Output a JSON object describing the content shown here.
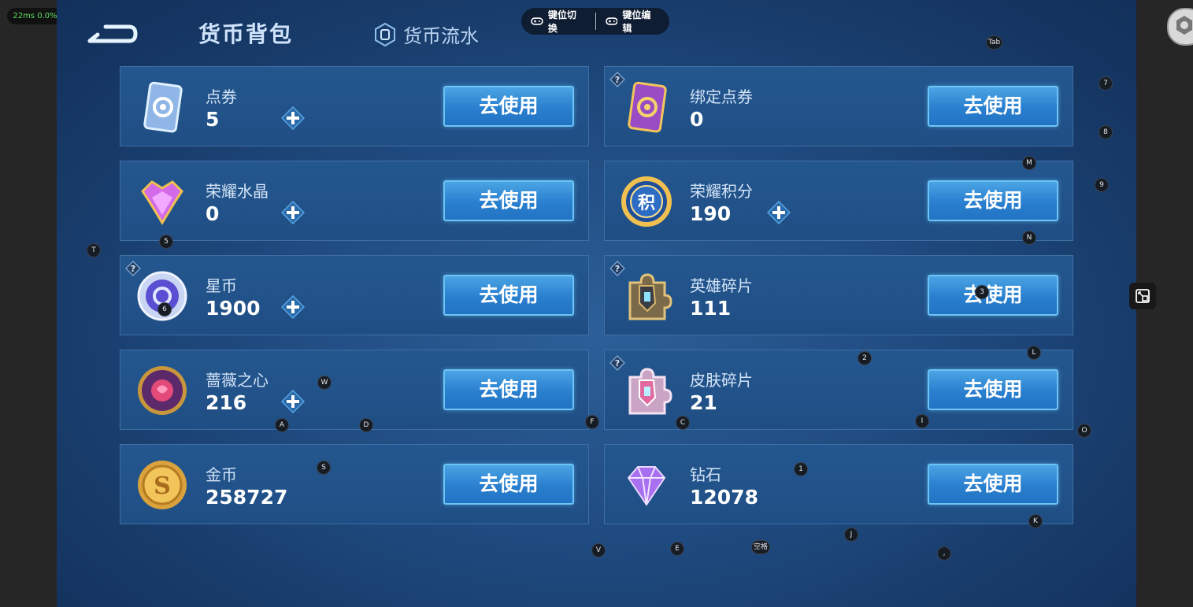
{
  "status": {
    "fps_latency": "22ms  0.0%"
  },
  "header": {
    "title": "货币背包",
    "flow_tab": "货币流水"
  },
  "key_toolbar": {
    "switch_label": "键位切换",
    "edit_label": "键位编辑"
  },
  "cards": [
    {
      "name": "点券",
      "value": "5",
      "button": "去使用",
      "has_plus": true,
      "has_help": false,
      "icon": "coupon-card-icon"
    },
    {
      "name": "绑定点券",
      "value": "0",
      "button": "去使用",
      "has_plus": false,
      "has_help": true,
      "icon": "bound-coupon-card-icon"
    },
    {
      "name": "荣耀水晶",
      "value": "0",
      "button": "去使用",
      "has_plus": true,
      "has_help": false,
      "icon": "glory-crystal-icon"
    },
    {
      "name": "荣耀积分",
      "value": "190",
      "button": "去使用",
      "has_plus": true,
      "has_help": false,
      "icon": "glory-points-icon"
    },
    {
      "name": "星币",
      "value": "1900",
      "button": "去使用",
      "has_plus": true,
      "has_help": true,
      "icon": "star-coin-icon"
    },
    {
      "name": "英雄碎片",
      "value": "111",
      "button": "去使用",
      "has_plus": false,
      "has_help": true,
      "icon": "hero-fragment-icon"
    },
    {
      "name": "蔷薇之心",
      "value": "216",
      "button": "去使用",
      "has_plus": true,
      "has_help": false,
      "icon": "rose-heart-icon"
    },
    {
      "name": "皮肤碎片",
      "value": "21",
      "button": "去使用",
      "has_plus": false,
      "has_help": true,
      "icon": "skin-fragment-icon"
    },
    {
      "name": "金币",
      "value": "258727",
      "button": "去使用",
      "has_plus": false,
      "has_help": false,
      "icon": "gold-coin-icon"
    },
    {
      "name": "钻石",
      "value": "12078",
      "button": "去使用",
      "has_plus": false,
      "has_help": false,
      "icon": "diamond-icon"
    }
  ],
  "key_hints": [
    "Tab",
    "7",
    "8",
    "M",
    "9",
    "N",
    "T",
    "5",
    "6",
    "3",
    "L",
    "2",
    "W",
    "F",
    "C",
    "I",
    "A",
    "D",
    "O",
    "S",
    "1",
    "K",
    "V",
    "E",
    "空格",
    "J",
    ","
  ],
  "colors": {
    "button": "#2a7fcf",
    "card_border": "#3f6ea3",
    "bg": "#1f4a7f"
  }
}
